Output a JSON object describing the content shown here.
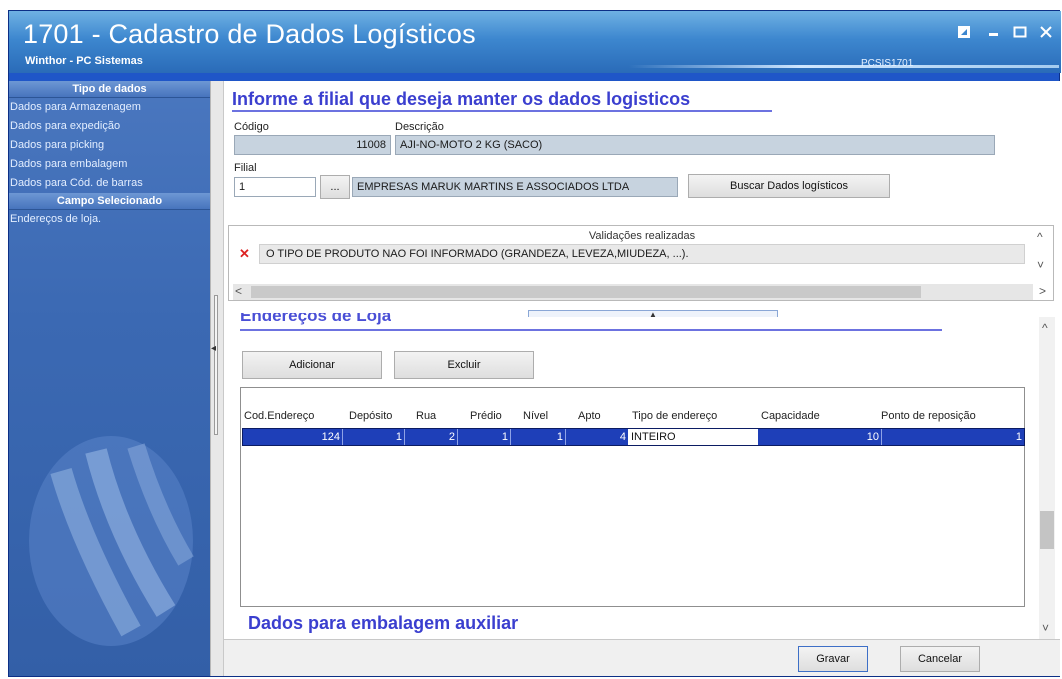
{
  "window": {
    "title": "1701 - Cadastro de Dados Logísticos",
    "company": "Winthor - PC Sistemas",
    "code": "PCSIS1701",
    "controls": [
      "restore-icon",
      "minimize-icon",
      "maximize-icon",
      "close-icon"
    ]
  },
  "sidebar": {
    "section1": "Tipo de dados",
    "items": [
      "Dados para Armazenagem",
      "Dados para expedição",
      "Dados para picking",
      "Dados para embalagem",
      "Dados para Cód. de barras"
    ],
    "section2": "Campo Selecionado",
    "selected": [
      "Endereços de loja."
    ]
  },
  "main": {
    "title": "Informe a filial que deseja manter os dados logisticos",
    "codigo_label": "Código",
    "codigo_value": "11008",
    "descricao_label": "Descrição",
    "descricao_value": "AJI-NO-MOTO 2 KG (SACO)",
    "filial_label": "Filial",
    "filial_value": "1",
    "filial_lookup": "...",
    "filial_name": "EMPRESAS MARUK MARTINS E ASSOCIADOS LTDA",
    "buscar_button": "Buscar Dados logísticos"
  },
  "validations": {
    "header": "Validações realizadas",
    "rows": [
      "O TIPO DE PRODUTO NAO FOI INFORMADO (GRANDEZA, LEVEZA,MIUDEZA, ...)."
    ]
  },
  "enderecos": {
    "section_title": "Endereços de Loja",
    "add_button": "Adicionar",
    "delete_button": "Excluir",
    "columns": [
      "Cod.Endereço",
      "Depósito",
      "Rua",
      "Prédio",
      "Nível",
      "Apto",
      "Tipo de endereço",
      "Capacidade",
      "Ponto de reposição"
    ],
    "rows": [
      [
        "124",
        "1",
        "2",
        "1",
        "1",
        "4",
        "INTEIRO",
        "10",
        "1"
      ]
    ]
  },
  "section3_title": "Dados para embalagem auxiliar",
  "footer": {
    "save_button": "Gravar",
    "cancel_button": "Cancelar"
  },
  "colors": {
    "window_blue": "#1f56c8",
    "title_accent": "#3b3fcf",
    "row_highlight": "#1e3fb8"
  }
}
